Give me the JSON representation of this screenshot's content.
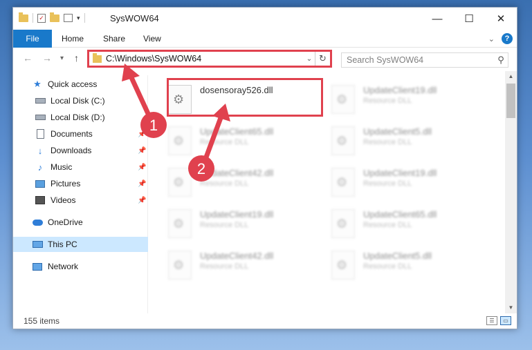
{
  "window": {
    "title": "SysWOW64",
    "controls": {
      "minimize": "—",
      "maximize": "☐",
      "close": "✕"
    }
  },
  "ribbon": {
    "tabs": [
      "File",
      "Home",
      "Share",
      "View"
    ],
    "help": "?"
  },
  "address": {
    "path": "C:\\Windows\\SysWOW64",
    "refresh": "↻"
  },
  "search": {
    "placeholder": "Search SysWOW64"
  },
  "sidebar": {
    "items": [
      {
        "label": "Quick access",
        "icon": "star-icon"
      },
      {
        "label": "Local Disk (C:)",
        "icon": "drive-icon"
      },
      {
        "label": "Local Disk (D:)",
        "icon": "drive-icon"
      },
      {
        "label": "Documents",
        "icon": "documents-icon",
        "pinned": true
      },
      {
        "label": "Downloads",
        "icon": "download-icon",
        "pinned": true
      },
      {
        "label": "Music",
        "icon": "music-icon",
        "pinned": true
      },
      {
        "label": "Pictures",
        "icon": "pictures-icon",
        "pinned": true
      },
      {
        "label": "Videos",
        "icon": "videos-icon",
        "pinned": true
      },
      {
        "label": "OneDrive",
        "icon": "onedrive-icon"
      },
      {
        "label": "This PC",
        "icon": "pc-icon",
        "selected": true
      },
      {
        "label": "Network",
        "icon": "network-icon"
      }
    ]
  },
  "files": {
    "highlighted": {
      "name": "dosensoray526.dll",
      "type": ""
    },
    "blurred": [
      {
        "name": "UpdateClient19.dll",
        "type": "Resource DLL"
      },
      {
        "name": "UpdateClient65.dll",
        "type": "Resource DLL"
      },
      {
        "name": "UpdateClient5.dll",
        "type": "Resource DLL"
      },
      {
        "name": "UpdateClient42.dll",
        "type": "Resource DLL"
      },
      {
        "name": "UpdateClient19.dll",
        "type": "Resource DLL"
      },
      {
        "name": "UpdateClient19.dll",
        "type": "Resource DLL"
      },
      {
        "name": "UpdateClient65.dll",
        "type": "Resource DLL"
      },
      {
        "name": "UpdateClient42.dll",
        "type": "Resource DLL"
      },
      {
        "name": "UpdateClient5.dll",
        "type": "Resource DLL"
      }
    ]
  },
  "status": {
    "items": "155 items"
  },
  "annotations": {
    "step1": "1",
    "step2": "2",
    "color": "#e0414e"
  }
}
